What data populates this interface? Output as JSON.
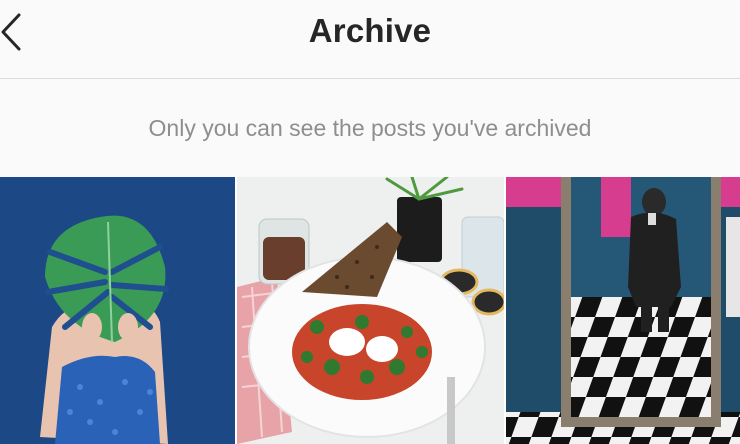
{
  "header": {
    "title": "Archive",
    "back_icon": "chevron-left-icon"
  },
  "notice": {
    "text": "Only you can see the posts you've archived"
  },
  "colors": {
    "background": "#fafafa",
    "title": "#262626",
    "secondary_text": "#8e8e8e",
    "divider": "#dbdbdb"
  },
  "posts": [
    {
      "subject": "monstera-leaf-portrait"
    },
    {
      "subject": "breakfast-plate"
    },
    {
      "subject": "mirror-selfie-checkered-floor"
    }
  ]
}
